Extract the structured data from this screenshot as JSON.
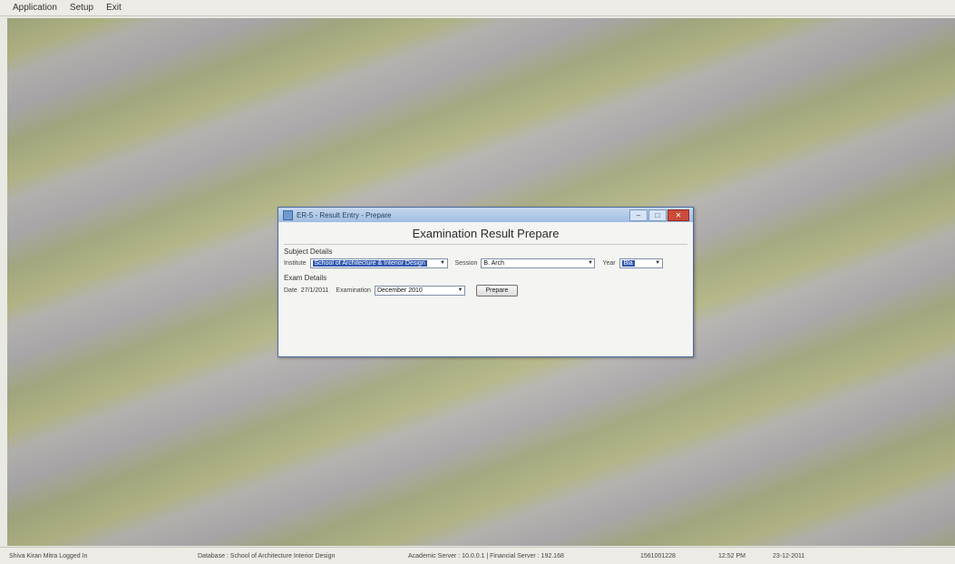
{
  "menu": {
    "items": [
      "Application",
      "Setup",
      "Exit"
    ]
  },
  "window": {
    "title": "ER-5 - Result Entry - Prepare",
    "heading": "Examination Result Prepare",
    "controls": {
      "minimize": "–",
      "maximize": "□",
      "close": "✕"
    },
    "group1": {
      "label": "Subject Details",
      "institute_label": "Institute",
      "institute_value": "School of Architecture & Interior Design",
      "session_label": "Session",
      "session_value": "B. Arch",
      "year_label": "Year",
      "year_value": "Bla"
    },
    "group2": {
      "label": "Exam Details",
      "date_label": "Date",
      "date_value": "27/1/2011",
      "examination_label": "Examination",
      "examination_value": "December 2010",
      "button_label": "Prepare"
    }
  },
  "status": {
    "user": "Shiva Kiran Mitra Logged In",
    "database": "Database : School of Architecture Interior Design",
    "version": "Academic Server : 10.0.0.1   | Financial Server : 192.168",
    "id": "1561001228",
    "time": "12:52 PM",
    "date": "23-12-2011"
  },
  "colors": {
    "title_bar": "#9fbde2",
    "close_button": "#cc4b3a",
    "selection": "#2f57b0"
  },
  "icons": {
    "window": "app-icon",
    "dropdown": "chevron-down-icon"
  }
}
